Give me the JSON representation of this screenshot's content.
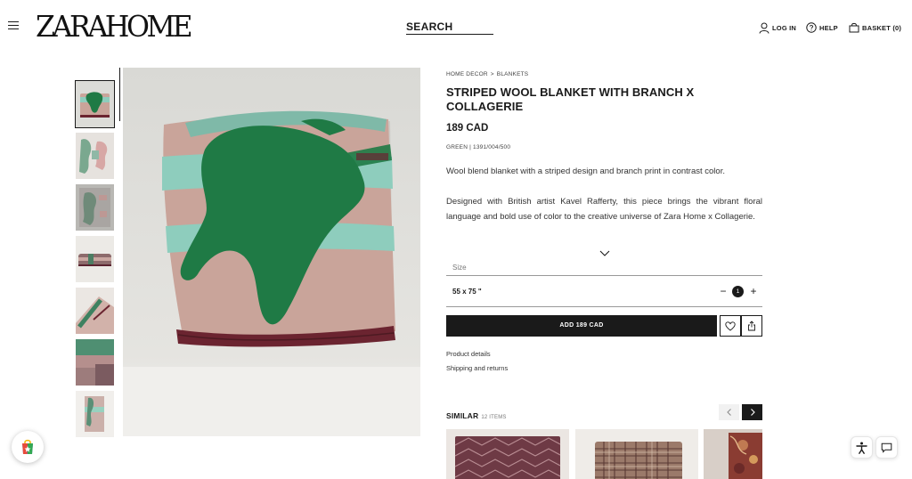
{
  "header": {
    "logo": "ZARAHOME",
    "search_label": "SEARCH",
    "login_label": "LOG IN",
    "help_label": "HELP",
    "basket_label": "BASKET (0)"
  },
  "gallery": {
    "thumbnails": [
      {
        "name": "thumb-folded-blanket",
        "active": true
      },
      {
        "name": "thumb-pattern-detail"
      },
      {
        "name": "thumb-full-blanket"
      },
      {
        "name": "thumb-rolled-blanket"
      },
      {
        "name": "thumb-corner-detail"
      },
      {
        "name": "thumb-texture-detail"
      },
      {
        "name": "thumb-draped-blanket"
      }
    ]
  },
  "product": {
    "breadcrumb": [
      "HOME DECOR",
      "BLANKETS"
    ],
    "breadcrumb_sep": ">",
    "title": "STRIPED WOOL BLANKET WITH BRANCH X COLLAGERIE",
    "price": "189 CAD",
    "reference": "GREEN | 1391/004/500",
    "description_1": "Wool blend blanket with a striped design and branch print in contrast color.",
    "description_2": "Designed with British artist Kavel Rafferty, this piece brings the vibrant floral language and bold use of color to the creative universe of Zara Home x Collagerie.",
    "size_label": "Size",
    "size_value": "55 x 75 \"",
    "quantity": "1",
    "qty_minus": "−",
    "qty_plus": "+",
    "add_button": "ADD 189 CAD",
    "links": [
      "Product details",
      "Shipping and returns"
    ]
  },
  "similar": {
    "title": "SIMILAR",
    "count": "12 ITEMS"
  },
  "colors": {
    "text": "#1a1a1a",
    "blanket_green": "#1f7a45",
    "blanket_teal": "#8ecdbd",
    "blanket_pink": "#c9a49a",
    "blanket_border": "#6b2430"
  }
}
